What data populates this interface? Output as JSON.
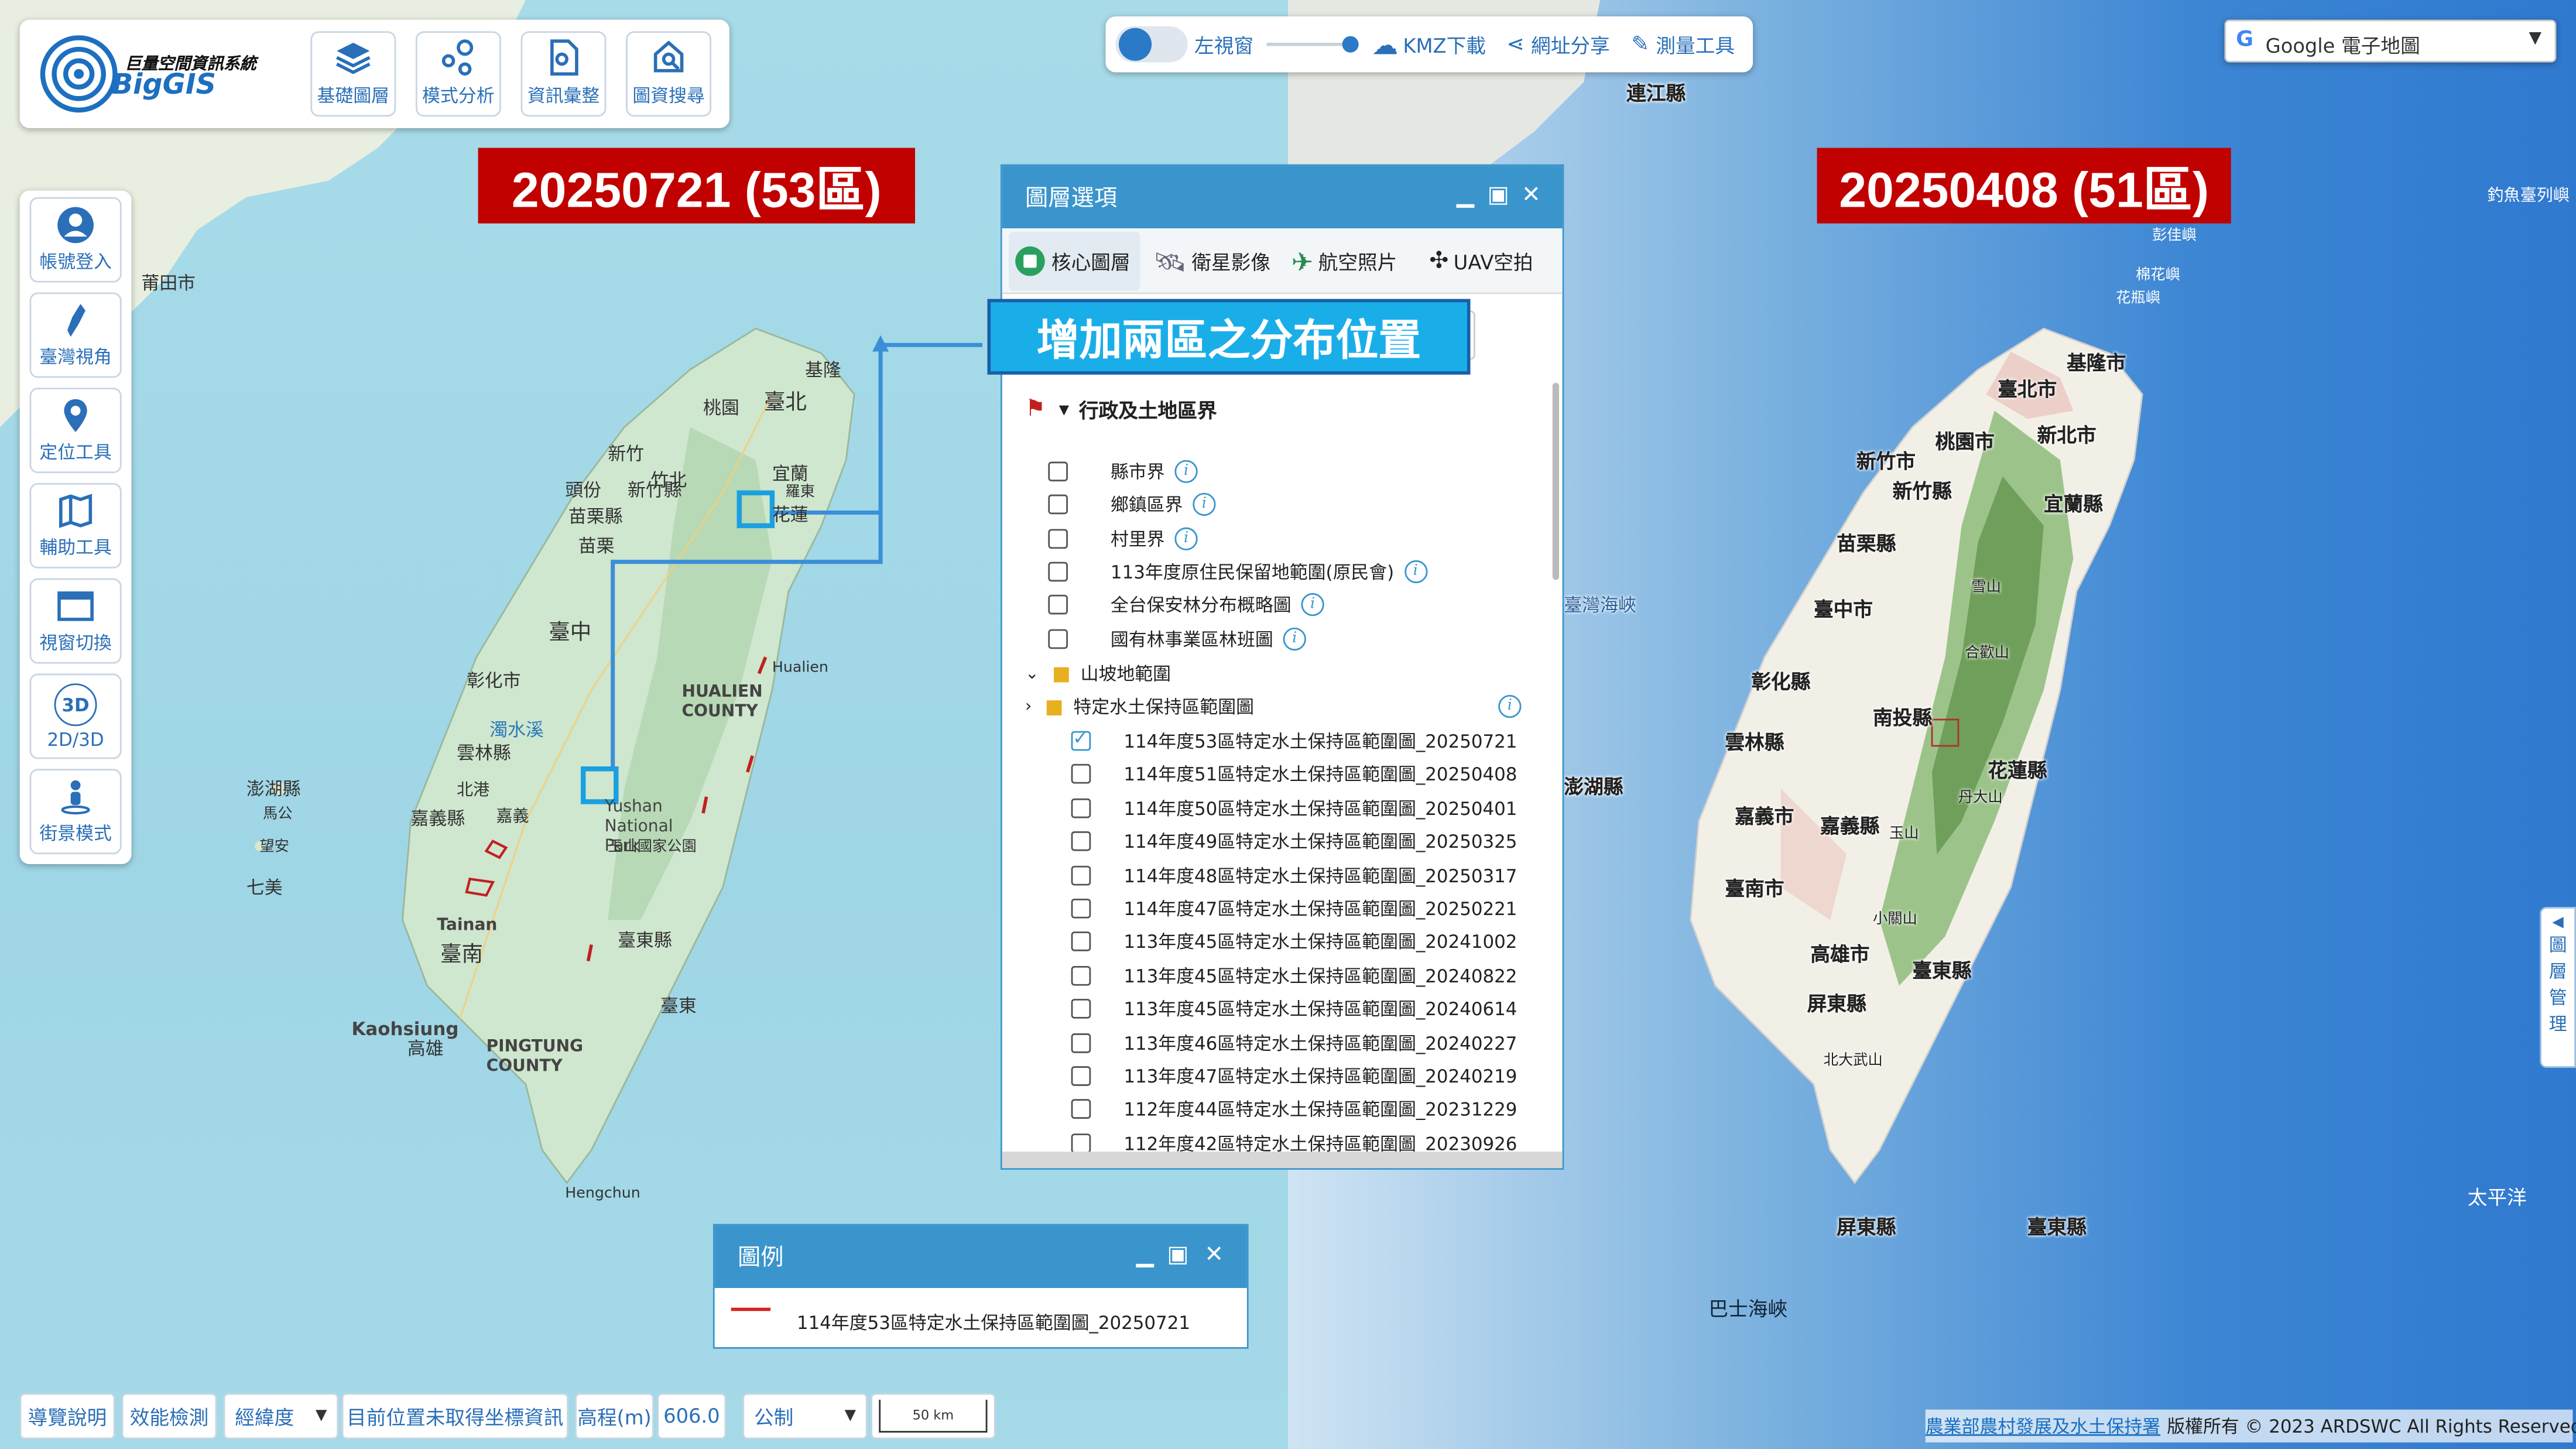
{
  "app": {
    "logo_title": "巨量空間資訊系統",
    "logo_name": "BigGIS"
  },
  "top_tools": [
    {
      "label": "基礎圖層",
      "icon": "layers-icon"
    },
    {
      "label": "模式分析",
      "icon": "analysis-icon"
    },
    {
      "label": "資訊彙整",
      "icon": "document-icon"
    },
    {
      "label": "圖資搜尋",
      "icon": "search-doc-icon"
    }
  ],
  "side_tools": [
    {
      "label": "帳號登入",
      "icon": "user-icon"
    },
    {
      "label": "臺灣視角",
      "icon": "taiwan-icon"
    },
    {
      "label": "定位工具",
      "icon": "location-pin-icon"
    },
    {
      "label": "輔助工具",
      "icon": "map-tool-icon"
    },
    {
      "label": "視窗切換",
      "icon": "window-icon"
    },
    {
      "label": "2D/3D",
      "icon": "3d-icon",
      "badge": "3D"
    },
    {
      "label": "街景模式",
      "icon": "street-view-icon"
    }
  ],
  "topbar": {
    "left_window": "左視窗",
    "kmz": "KMZ下載",
    "share": "網址分享",
    "measure": "測量工具"
  },
  "basemap_select": {
    "value": "Google 電子地圖",
    "g": "G"
  },
  "banners": {
    "left": "20250721 (53區)",
    "right": "20250408 (51區)",
    "callout": "增加兩區之分布位置"
  },
  "layer_window": {
    "title": "圖層選項",
    "tabs": [
      "核心圖層",
      "衛星影像",
      "航空照片",
      "UAV空拍"
    ],
    "group_title": "行政及土地區界",
    "search_tail": "t",
    "items": [
      {
        "label": "縣市界",
        "checked": false
      },
      {
        "label": "鄉鎮區界",
        "checked": false
      },
      {
        "label": "村里界",
        "checked": false
      },
      {
        "label": "113年度原住民保留地範圍(原民會)",
        "checked": false
      },
      {
        "label": "全台保安林分布概略圖",
        "checked": false
      },
      {
        "label": "國有林事業區林班圖",
        "checked": false
      }
    ],
    "folder1": "山坡地範圍",
    "folder2": "特定水土保持區範圍圖",
    "sub_items": [
      {
        "label": "114年度53區特定水土保持區範圍圖_20250721",
        "checked": true
      },
      {
        "label": "114年度51區特定水土保持區範圍圖_20250408",
        "checked": false
      },
      {
        "label": "114年度50區特定水土保持區範圍圖_20250401",
        "checked": false
      },
      {
        "label": "114年度49區特定水土保持區範圍圖_20250325",
        "checked": false
      },
      {
        "label": "114年度48區特定水土保持區範圍圖_20250317",
        "checked": false
      },
      {
        "label": "114年度47區特定水土保持區範圍圖_20250221",
        "checked": false
      },
      {
        "label": "113年度45區特定水土保持區範圍圖_20241002",
        "checked": false
      },
      {
        "label": "113年度45區特定水土保持區範圍圖_20240822",
        "checked": false
      },
      {
        "label": "113年度45區特定水土保持區範圍圖_20240614",
        "checked": false
      },
      {
        "label": "113年度46區特定水土保持區範圍圖_20240227",
        "checked": false
      },
      {
        "label": "113年度47區特定水土保持區範圍圖_20240219",
        "checked": false
      },
      {
        "label": "112年度44區特定水土保持區範圍圖_20231229",
        "checked": false
      },
      {
        "label": "112年度42區特定水土保持區範圍圖_20230926",
        "checked": false
      }
    ]
  },
  "legend_window": {
    "title": "圖例",
    "item": "114年度53區特定水土保持區範圍圖_20250721",
    "line_color": "#d62020"
  },
  "bottom": {
    "guide": "導覽說明",
    "perf": "效能檢測",
    "coord_select": "經緯度",
    "coord_msg": "目前位置未取得坐標資訊",
    "elev_label": "高程(m)",
    "elev_value": "606.0",
    "unit_select": "公制",
    "scale": "50 km"
  },
  "right_tab": {
    "arrow": "◀",
    "chars": [
      "圖",
      "層",
      "管",
      "理"
    ]
  },
  "copyright": {
    "agency": "農業部農村發展及水土保持署",
    "rights": "版權所有 © 2023 ARDSWC All Rights Reserved."
  },
  "left_map_labels": [
    "莆田市",
    "臺北",
    "桃園",
    "新竹",
    "頭份",
    "苗栗",
    "臺中",
    "彰化市",
    "雲林縣",
    "嘉義縣",
    "臺南",
    "高雄",
    "花蓮",
    "宜蘭",
    "基隆",
    "澎湖縣",
    "HUALIEN COUNTY",
    "Kaohsiung",
    "PINGTUNG COUNTY",
    "Tainan",
    "Yushan National Park",
    "Hengchun",
    "臺東縣",
    "馬公",
    "望安",
    "七美",
    "玉山國家公園",
    "羅東",
    "濁水溪",
    "北港",
    "嘉義",
    "竹北",
    "新竹縣",
    "苗栗縣",
    "臺東",
    "Hualien"
  ],
  "right_map_labels": [
    "連江縣",
    "基隆市",
    "臺北市",
    "桃園市",
    "新北市",
    "新竹市",
    "新竹縣",
    "宜蘭縣",
    "苗栗縣",
    "臺中市",
    "彰化縣",
    "南投縣",
    "花蓮縣",
    "雲林縣",
    "嘉義市",
    "嘉義縣",
    "臺南市",
    "高雄市",
    "臺東縣",
    "屏東縣",
    "玉山",
    "丹大山",
    "合歡山",
    "雪山",
    "小關山",
    "北大武山",
    "臺灣海峽",
    "澎湖縣",
    "巴士海峽",
    "太平洋",
    "釣魚臺列嶼",
    "彭佳嶼",
    "棉花嶼",
    "花瓶嶼"
  ]
}
